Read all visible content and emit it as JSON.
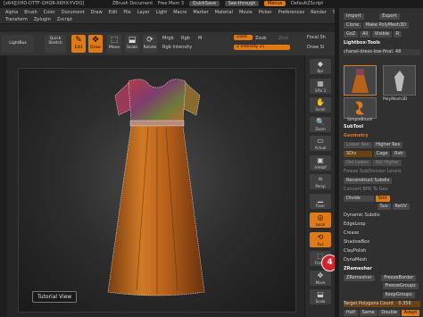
{
  "titlebar": {
    "left_text": "[x64][XHD-DTTF-QHQR-XKHX-YVDQ]",
    "doc": "ZBrush Document",
    "mem": "Free Mem 3",
    "quicksave": "QuickSave",
    "seethrough": "See-through",
    "menus": "Menus",
    "script": "DefaultZScript"
  },
  "menubar": {
    "row1": [
      "Alpha",
      "Brush",
      "Color",
      "Document",
      "Draw",
      "Edit",
      "File",
      "Layer",
      "Light",
      "Macro",
      "Marker",
      "Material",
      "Movie",
      "Picker",
      "Preferences",
      "Render",
      "Stencil",
      "Stroke",
      "Texture",
      "Tool"
    ],
    "row2": [
      "Transform",
      "Zplugin",
      "Zscript"
    ]
  },
  "toolbar": {
    "lightbox": "LightBox",
    "quicksketch": "Quick Sketch",
    "edit": "Edit",
    "draw": "Draw",
    "move": "Move",
    "scale": "Scale",
    "rotate": "Rotate",
    "mrgb": "Mrgb",
    "rgb": "Rgb",
    "m": "M",
    "rgb_intensity": "Rgb Intensity",
    "zadd": "Zadd",
    "zsub": "Zsub",
    "zcut": "Zcut",
    "z_intensity": "Z Intensity 25",
    "focal": "Focal Sh",
    "draw_size": "Draw Si"
  },
  "shelf": {
    "items": [
      "Bpr",
      "SPix 3",
      "Scroll",
      "Zoom",
      "Actual",
      "AAHalf",
      "Persp",
      "Floor",
      "Local",
      "Xyz",
      "Frame",
      "Move",
      "Scale"
    ]
  },
  "canvas": {
    "tutorial": "Tutorial View"
  },
  "badge": "4",
  "panel": {
    "import": "Import",
    "export": "Export",
    "clone": "Clone",
    "make_polymesh": "Make PolyMesh3D",
    "goz": "GoZ",
    "all": "All",
    "visible": "Visible",
    "r": "R",
    "lightbox_tools": "Lightbox›Tools",
    "tool_name": "chanel-dress-low-final. 48",
    "thumb1": "chanel-dress",
    "thumb2": "PolyMesh3D",
    "thumb3": "SimpleBrush",
    "subtool": "SubTool",
    "geometry": "Geometry",
    "lower_res": "Lower Res",
    "higher_res": "Higher Res",
    "sdiv": "SDiv",
    "cage": "Cage",
    "rstr": "Rstr",
    "del_lower": "Del Lower",
    "del_higher": "Del Higher",
    "freeze_subdiv": "Freeze SubDivision Levels",
    "reconstruct": "Reconstruct Subdiv",
    "convert_bpr": "Convert BPR To Geo",
    "divide": "Divide",
    "smt": "Smt",
    "suv": "Suv",
    "reuv": "ReUV",
    "dynamic_subdiv": "Dynamic Subdiv",
    "edgeloop": "EdgeLoop",
    "crease": "Crease",
    "shadowbox": "ShadowBox",
    "claypolish": "ClayPolish",
    "dynamesh": "DynaMesh",
    "zremesher": "ZRemesher",
    "zremesher2": "ZRemesher",
    "freezeborder": "FreezeBorder",
    "freezegroups": "FreezeGroups",
    "keepgroups": "KeepGroups",
    "target_poly": "Target Polygons Count",
    "target_val": "0.356",
    "half": "Half",
    "same": "Same",
    "double": "Double",
    "adapt": "Adapt"
  }
}
